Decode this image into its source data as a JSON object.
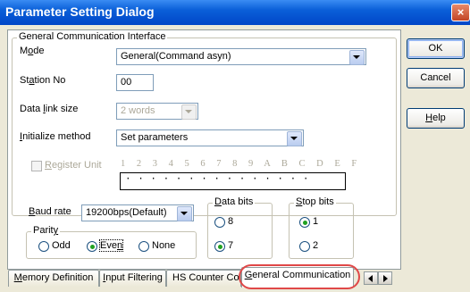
{
  "window": {
    "title": "Parameter Setting Dialog",
    "close_glyph": "×"
  },
  "group_general": {
    "legend": "General Communication Interface"
  },
  "mode": {
    "label_pre": "M",
    "label_ul": "o",
    "label_post": "de",
    "value": "General(Command asyn)"
  },
  "station": {
    "label_pre": "St",
    "label_ul": "a",
    "label_post": "tion No",
    "value": "00"
  },
  "data_link": {
    "label_pre": "Data ",
    "label_ul": "l",
    "label_post": "ink size",
    "value": "2 words"
  },
  "init": {
    "label_pre": "",
    "label_ul": "I",
    "label_post": "nitialize method",
    "value": "Set parameters"
  },
  "register": {
    "label_pre": "",
    "label_ul": "R",
    "label_post": "egister Unit",
    "letters": "1 2 3 4 5 6 7 8 9 A B C D E F",
    "bits": "···············"
  },
  "baud": {
    "label_pre": "",
    "label_ul": "B",
    "label_post": "aud rate",
    "value": "19200bps(Default)"
  },
  "parity": {
    "legend_pre": "Parit",
    "legend_ul": "y",
    "options": [
      "Odd",
      "Even",
      "None"
    ],
    "even_pre": "Eve",
    "even_ul": "n",
    "selected": "Even"
  },
  "data_bits": {
    "legend_pre": "",
    "legend_ul": "D",
    "legend_post": "ata bits",
    "options": [
      "8",
      "7"
    ],
    "selected": "7"
  },
  "stop_bits": {
    "legend_pre": "",
    "legend_ul": "S",
    "legend_post": "top bits",
    "options": [
      "1",
      "2"
    ],
    "selected": "1"
  },
  "buttons": {
    "ok": "OK",
    "cancel": "Cancel",
    "help_ul": "H",
    "help_post": "elp"
  },
  "tabs": [
    {
      "pre": "",
      "ul": "M",
      "post": "emory Definition"
    },
    {
      "pre": "",
      "ul": "I",
      "post": "nput Filtering"
    },
    {
      "pre": "HS Counter Confi",
      "ul": "",
      "post": ""
    },
    {
      "pre": "",
      "ul": "G",
      "post": "eneral Communication",
      "active": true
    }
  ]
}
